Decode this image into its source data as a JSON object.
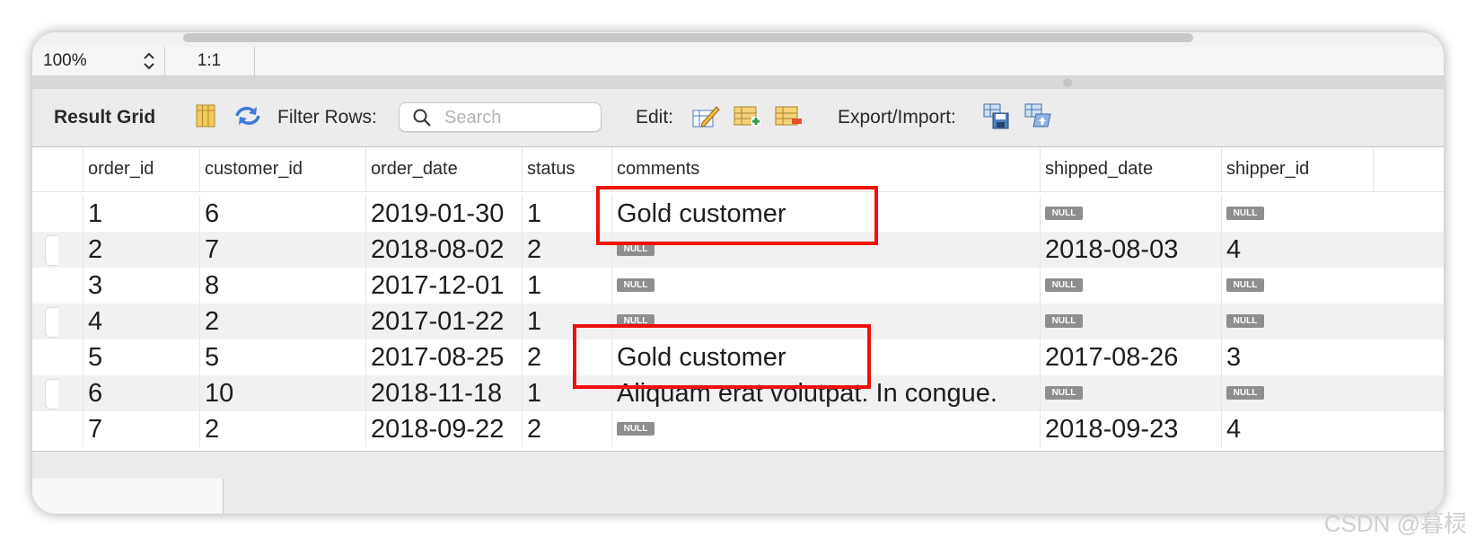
{
  "zoom": {
    "level": "100%",
    "ratio": "1:1"
  },
  "toolbar": {
    "title": "Result Grid",
    "filter_label": "Filter Rows:",
    "search_placeholder": "Search",
    "edit_label": "Edit:",
    "export_label": "Export/Import:"
  },
  "columns": [
    "order_id",
    "customer_id",
    "order_date",
    "status",
    "comments",
    "shipped_date",
    "shipper_id"
  ],
  "rows": [
    [
      "1",
      "6",
      "2019-01-30",
      "1",
      "Gold customer",
      "NULL",
      "NULL"
    ],
    [
      "2",
      "7",
      "2018-08-02",
      "2",
      "NULL",
      "2018-08-03",
      "4"
    ],
    [
      "3",
      "8",
      "2017-12-01",
      "1",
      "NULL",
      "NULL",
      "NULL"
    ],
    [
      "4",
      "2",
      "2017-01-22",
      "1",
      "NULL",
      "NULL",
      "NULL"
    ],
    [
      "5",
      "5",
      "2017-08-25",
      "2",
      "Gold customer",
      "2017-08-26",
      "3"
    ],
    [
      "6",
      "10",
      "2018-11-18",
      "1",
      "Aliquam erat volutpat. In congue.",
      "NULL",
      "NULL"
    ],
    [
      "7",
      "2",
      "2018-09-22",
      "2",
      "NULL",
      "2018-09-23",
      "4"
    ]
  ],
  "null_label": "NULL",
  "colors": {
    "highlight": "#ef0f0f",
    "null_badge": "#8e8e8e",
    "alt_row": "#f1f1f1"
  },
  "watermark": "CSDN @暮棂"
}
